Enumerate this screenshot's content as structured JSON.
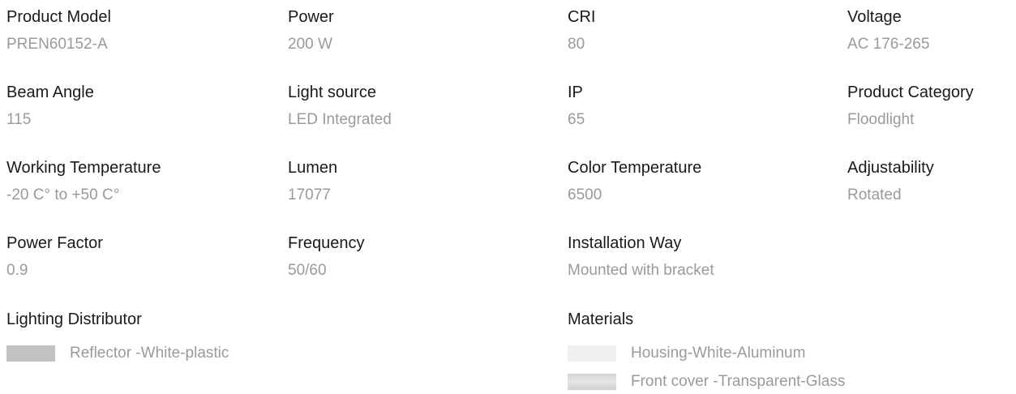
{
  "specs": {
    "product_model": {
      "label": "Product Model",
      "value": "PREN60152-A"
    },
    "power": {
      "label": "Power",
      "value": "200 W"
    },
    "cri": {
      "label": "CRI",
      "value": "80"
    },
    "voltage": {
      "label": "Voltage",
      "value": "AC 176-265"
    },
    "beam_angle": {
      "label": "Beam Angle",
      "value": "115"
    },
    "light_source": {
      "label": "Light source",
      "value": "LED Integrated"
    },
    "ip": {
      "label": "IP",
      "value": "65"
    },
    "product_category": {
      "label": "Product Category",
      "value": "Floodlight"
    },
    "working_temperature": {
      "label": "Working Temperature",
      "value": "-20 C° to +50 C°"
    },
    "lumen": {
      "label": "Lumen",
      "value": "17077"
    },
    "color_temperature": {
      "label": "Color Temperature",
      "value": "6500"
    },
    "adjustability": {
      "label": "Adjustability",
      "value": "Rotated"
    },
    "power_factor": {
      "label": "Power Factor",
      "value": "0.9"
    },
    "frequency": {
      "label": "Frequency",
      "value": "50/60"
    },
    "installation_way": {
      "label": "Installation Way",
      "value": "Mounted with bracket"
    }
  },
  "lighting_distributor": {
    "title": "Lighting Distributor",
    "items": [
      {
        "text": "Reflector -White-plastic",
        "swatch_color": "#c2c2c2"
      }
    ]
  },
  "materials": {
    "title": "Materials",
    "items": [
      {
        "text": "Housing-White-Aluminum",
        "swatch_color": "#f0f0f0"
      },
      {
        "text": "Front cover -Transparent-Glass",
        "swatch_color": "#dadada"
      }
    ]
  }
}
